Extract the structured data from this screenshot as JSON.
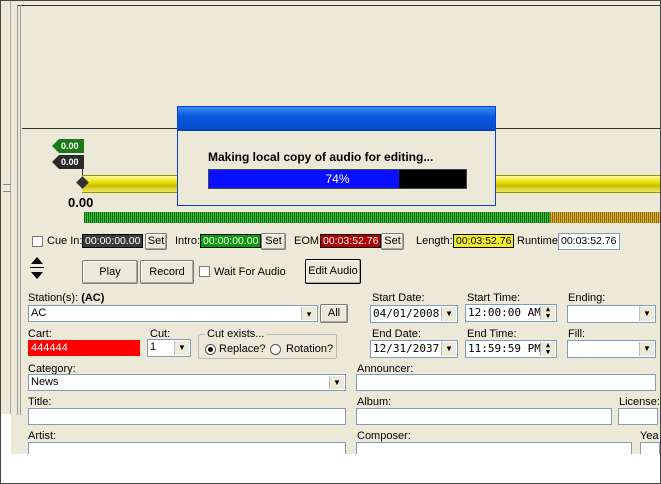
{
  "dialog": {
    "message": "Making local copy of audio for editing...",
    "progress_text": "74%",
    "progress": 0.74
  },
  "waveform": {
    "marker_top": "0.00",
    "marker_bottom": "0.00",
    "position": "0.00"
  },
  "markers": {
    "cue_in_label": "Cue In:",
    "cue_in_value": "00:00:00.00",
    "intro_label": "Intro:",
    "intro_value": "00:00:00.00",
    "eom_label": "EOM:",
    "eom_value": "00:03:52.76",
    "set_label": "Set",
    "length_label": "Length:",
    "length_value": "00:03:52.76",
    "runtime_label": "Runtime:",
    "runtime_value": "00:03:52.76"
  },
  "controls": {
    "play": "Play",
    "record": "Record",
    "wait_for_audio": "Wait For Audio",
    "edit_audio": "Edit Audio"
  },
  "station": {
    "label": "Station(s):",
    "label_bold": "(AC)",
    "value": "AC",
    "all_button": "All"
  },
  "cart": {
    "label": "Cart:",
    "value": "444444"
  },
  "cut": {
    "label": "Cut:",
    "value": "1"
  },
  "cut_exists": {
    "legend": "Cut exists...",
    "replace": "Replace?",
    "rotation": "Rotation?"
  },
  "dates": {
    "start_date_label": "Start Date:",
    "start_date": "04/01/2008",
    "start_time_label": "Start Time:",
    "start_time": "12:00:00 AM",
    "ending_label": "Ending:",
    "end_date_label": "End Date:",
    "end_date": "12/31/2037",
    "end_time_label": "End Time:",
    "end_time": "11:59:59 PM",
    "fill_label": "Fill:"
  },
  "category": {
    "label": "Category:",
    "value": "News"
  },
  "announcer": {
    "label": "Announcer:"
  },
  "title": {
    "label": "Title:"
  },
  "album": {
    "label": "Album:"
  },
  "license": {
    "label": "License:"
  },
  "artist": {
    "label": "Artist:"
  },
  "composer": {
    "label": "Composer:"
  },
  "year": {
    "label": "Yea"
  },
  "colors": {
    "cue_in_bg": "#3a3a3a",
    "intro_bg": "#0a9a0a",
    "eom_bg": "#b00000",
    "length_bg": "#f2ef2a",
    "cart_bg": "#ff0000",
    "progress_fill": "#0a10ff",
    "titlebar": "#0a5ae0"
  }
}
